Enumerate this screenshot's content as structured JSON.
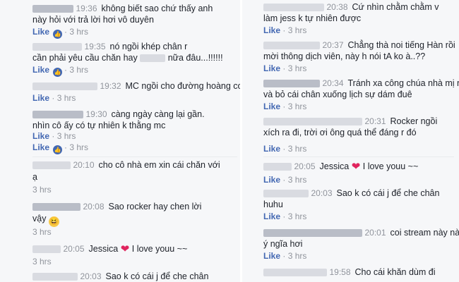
{
  "left": [
    {
      "time": "19:36",
      "text": [
        "không biết sao chứ thấy anh",
        "này hỏi với trả lời hơi vô duyên"
      ],
      "like": "Like",
      "dot": "·",
      "age": "3 hrs",
      "react": true
    },
    {
      "time": "19:35",
      "text": [
        "nó ngồi khép chân r",
        "cần phải yêu cầu chăn hay",
        "nữa đâu...!!!!!!"
      ],
      "like": "Like",
      "dot": "·",
      "age": "3 hrs",
      "react": true
    },
    {
      "time": "19:32",
      "text": [
        "MC ngồi cho đường hoàng coi"
      ],
      "like": "Like",
      "dot": "·",
      "age": "3 hrs"
    },
    {
      "time": "19:30",
      "text": [
        "càng ngày càng lại gần.",
        "nhìn cô ấy có tự nhiên k thằng mc"
      ],
      "like": "Like",
      "dot": "·",
      "age": "3 hrs",
      "react": true
    },
    {
      "time": "20:10",
      "text": [
        "cho cô nhà em xin cái chăn với",
        "ạ"
      ],
      "like": "",
      "dot": "",
      "age": "3 hrs"
    },
    {
      "time": "20:08",
      "text": [
        "Sao rocker hay chen lời",
        "vậy"
      ],
      "like": "",
      "dot": "",
      "age": "3 hrs"
    },
    {
      "time": "20:05",
      "text": [
        "Jessica",
        "I love youu ~~"
      ],
      "like": "",
      "dot": "",
      "age": "3 hrs"
    },
    {
      "time": "20:03",
      "text": [
        "Sao k có cái j để che chân"
      ],
      "like": "",
      "dot": "",
      "age": ""
    }
  ],
  "right": [
    {
      "time": "20:38",
      "text": [
        "Cứ nhìn chằm chằm v",
        "làm jess k tự nhiên được"
      ],
      "like": "Like",
      "dot": "·",
      "age": "3 hrs"
    },
    {
      "time": "20:37",
      "text": [
        "Chẳng thà noi tiếng Hàn rồi",
        "mời thông dịch viên, này h nói tA ko à..??"
      ],
      "like": "Like",
      "dot": "·",
      "age": "3 hrs"
    },
    {
      "time": "20:34",
      "text": [
        "Tránh xa công chúa nhà mị ra",
        "và bỏ cái chân xuống lịch sự dám đuê"
      ],
      "like": "Like",
      "dot": "·",
      "age": "3 hrs"
    },
    {
      "time": "20:31",
      "text": [
        "Rocker ngồi",
        "xích ra đi, trời ơi ông quá thể đáng r đó"
      ],
      "like": "Like",
      "dot": "·",
      "age": "3 hrs"
    },
    {
      "time": "20:05",
      "text": [
        "Jessica",
        "I love youu ~~"
      ],
      "like": "Like",
      "dot": "·",
      "age": "3 hrs"
    },
    {
      "time": "20:03",
      "text": [
        "Sao k có cái j để che chân",
        "huhu"
      ],
      "like": "Like",
      "dot": "·",
      "age": "3 hrs"
    },
    {
      "time": "20:01",
      "text": [
        "coi stream này này",
        "ý ngĩa hơi"
      ],
      "like": "Like",
      "dot": "·",
      "age": "3 hrs"
    },
    {
      "time": "19:58",
      "text": [
        "Cho cái khăn dùm đi"
      ],
      "like": "",
      "dot": "",
      "age": ""
    }
  ],
  "icons": {
    "thumb": "thumbs-up-icon",
    "heart": "heart-icon",
    "laugh": "laughing-emoji-icon"
  },
  "colors": {
    "link": "#4267b2",
    "time": "#90949c",
    "heart": "#e0245e"
  }
}
